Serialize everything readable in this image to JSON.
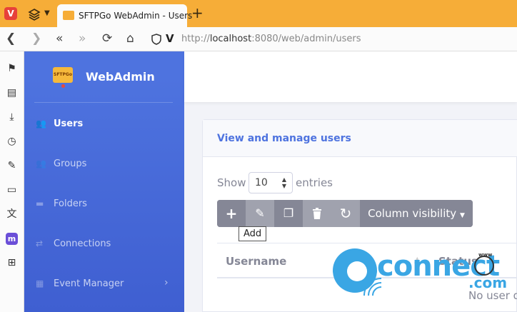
{
  "browser": {
    "tab_title": "SFTPGo WebAdmin - Users",
    "new_tab": "+",
    "url_scheme": "http://",
    "url_host": "localhost",
    "url_rest": ":8080/web/admin/users",
    "nav": {
      "back": "❮",
      "forward": "❯",
      "rewind": "«",
      "fast_forward": "»",
      "reload": "⟳",
      "home": "⌂"
    }
  },
  "side_panel": {
    "items": [
      "bookmarks-icon",
      "reader-icon",
      "downloads-icon",
      "history-icon",
      "notes-icon",
      "window-icon",
      "translate-icon",
      "mastodon-icon",
      "add-panel-icon"
    ]
  },
  "sidebar": {
    "brand_logo": "SFTPGo",
    "brand_name": "WebAdmin",
    "items": [
      {
        "label": "Users",
        "icon": "users-icon",
        "active": true
      },
      {
        "label": "Groups",
        "icon": "groups-icon",
        "active": false
      },
      {
        "label": "Folders",
        "icon": "folder-icon",
        "active": false
      },
      {
        "label": "Connections",
        "icon": "exchange-icon",
        "active": false
      },
      {
        "label": "Event Manager",
        "icon": "calendar-icon",
        "active": false
      }
    ],
    "expand_glyph": "›"
  },
  "card": {
    "title": "View and manage users",
    "show_label": "Show",
    "page_length": "10",
    "entries_label": "entries",
    "toolbar": {
      "add": "+",
      "edit": "✎",
      "clone": "❐",
      "delete": "🗑",
      "refresh": "↻",
      "column_visibility": "Column visibility"
    },
    "tooltip": "Add",
    "columns": [
      "Username",
      "Status"
    ],
    "empty_message": "No user d"
  },
  "watermark": {
    "text": "connect",
    "suffix": ".com",
    "www": "www"
  },
  "colors": {
    "sidebar": "#4e73df",
    "tabbar": "#f6ad38",
    "toolbar_button": "#858796",
    "watermark": "#3aa6e4"
  }
}
